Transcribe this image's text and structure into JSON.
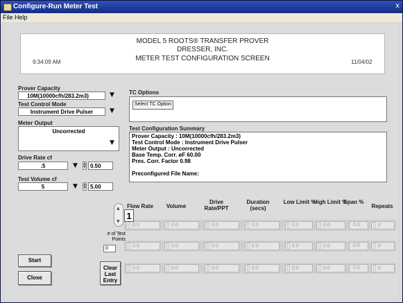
{
  "window": {
    "title": "Configure-Run Meter Test",
    "close_glyph": "x"
  },
  "menu": {
    "file": "File",
    "help": "Help"
  },
  "header": {
    "line1": "MODEL 5 ROOTS® TRANSFER PROVER",
    "line2": "DRESSER, INC.",
    "line3": "METER TEST CONFIGURATION SCREEN",
    "time": "9:34:09 AM",
    "date": "11/04/02"
  },
  "left": {
    "prover_capacity_label": "Prover Capacity",
    "prover_capacity_value": "10M(10000cfh/283.2m3)",
    "test_control_label": "Test Control Mode",
    "test_control_value": "Instrument Drive Pulser",
    "meter_output_label": "Meter Output",
    "meter_output_value": "Uncorrected",
    "drive_rate_label": "Drive Rate cf",
    "drive_rate_value": ".5",
    "drive_rate_num": "0.50",
    "test_volume_label": "Test Volume cf",
    "test_volume_value": "5",
    "test_volume_num": "5.00"
  },
  "tc_options": {
    "label": "TC Options",
    "select_button": "Select TC Option"
  },
  "summary": {
    "label": "Test Configuration Summary",
    "lines": [
      "Prover Capacity : 10M(10000cfh/283.2m3)",
      "Test Control Mode : Instrument Drive Pulser",
      "Meter Output : Uncorrected",
      "Base Temp. Corr. øF 60.00",
      "Pres. Corr. Factor 0.98",
      "",
      "Preconfigured File Name:"
    ]
  },
  "table": {
    "headers": [
      "Flow Rate",
      "Volume",
      "Drive Rate/PPT",
      "Duration (secs)",
      "Low Limit %",
      "High Limit %",
      "Span %",
      "Repeats"
    ],
    "rows": [
      [
        "0.0",
        "0.0",
        "0.0",
        "0.0",
        "0.0",
        "0.0",
        "0.0",
        "0"
      ],
      [
        "0.0",
        "0.0",
        "0.0",
        "0.0",
        "0.0",
        "0.0",
        "0.0",
        "0"
      ],
      [
        "0.0",
        "0.0",
        "0.0",
        "0.0",
        "0.0",
        "0.0",
        "0.0",
        "0"
      ]
    ]
  },
  "counter": {
    "value": "1",
    "points_label": "# of Test Points",
    "points_value": "0"
  },
  "buttons": {
    "start": "Start",
    "close": "Close",
    "clear": "Clear Last Entry"
  }
}
